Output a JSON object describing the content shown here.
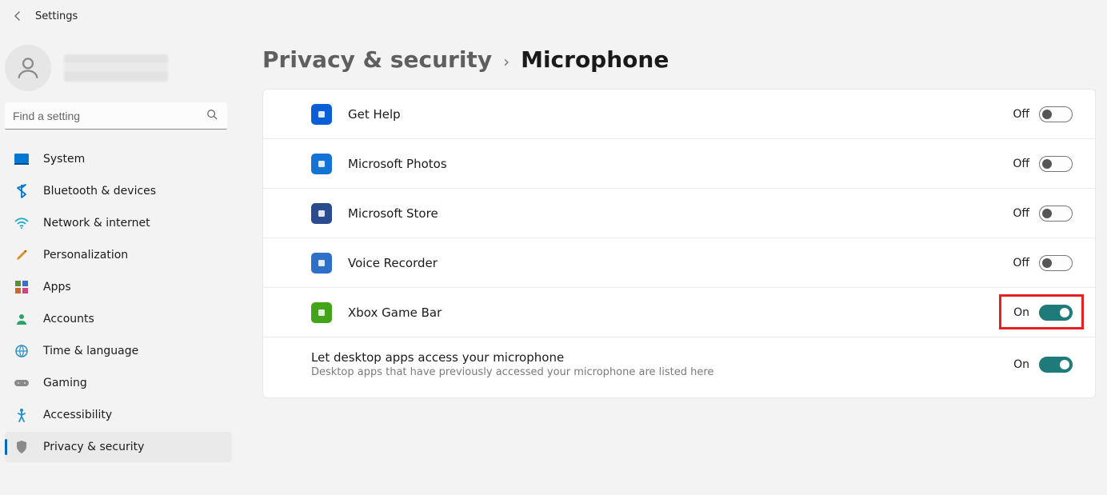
{
  "top": {
    "title": "Settings"
  },
  "search": {
    "placeholder": "Find a setting"
  },
  "nav": {
    "items": [
      {
        "label": "System"
      },
      {
        "label": "Bluetooth & devices"
      },
      {
        "label": "Network & internet"
      },
      {
        "label": "Personalization"
      },
      {
        "label": "Apps"
      },
      {
        "label": "Accounts"
      },
      {
        "label": "Time & language"
      },
      {
        "label": "Gaming"
      },
      {
        "label": "Accessibility"
      },
      {
        "label": "Privacy & security"
      }
    ]
  },
  "breadcrumb": {
    "parent": "Privacy & security",
    "sep": "›",
    "current": "Microphone"
  },
  "toggle_labels": {
    "on": "On",
    "off": "Off"
  },
  "apps": [
    {
      "label": "Get Help",
      "state": "off",
      "icon_bg": "#0a5fd6",
      "name": "get-help"
    },
    {
      "label": "Microsoft Photos",
      "state": "off",
      "icon_bg": "#1573d6",
      "name": "microsoft-photos"
    },
    {
      "label": "Microsoft Store",
      "state": "off",
      "icon_bg": "#2a4b8d",
      "name": "microsoft-store"
    },
    {
      "label": "Voice Recorder",
      "state": "off",
      "icon_bg": "#2e6fc7",
      "name": "voice-recorder"
    },
    {
      "label": "Xbox Game Bar",
      "state": "on",
      "icon_bg": "#43a41a",
      "name": "xbox-game-bar",
      "highlight": true
    }
  ],
  "desktop": {
    "title": "Let desktop apps access your microphone",
    "subtitle": "Desktop apps that have previously accessed your microphone are listed here",
    "state": "on"
  }
}
